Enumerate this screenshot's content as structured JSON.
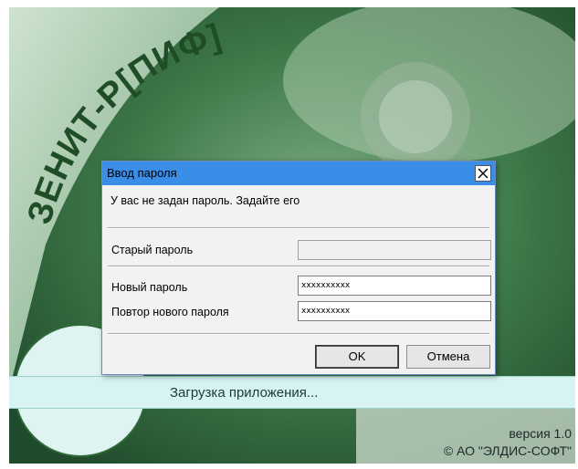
{
  "splash": {
    "brand": "ЗЕНИТ-Р[ПИФ]",
    "loading": "Загрузка приложения...",
    "version": "версия 1.0",
    "copyright": "© АО \"ЭЛДИС-СОФТ\""
  },
  "dialog": {
    "title": "Ввод пароля",
    "message": "У вас не задан пароль. Задайте его",
    "old_password_label": "Старый пароль",
    "old_password_value": "",
    "new_password_label": "Новый пароль",
    "new_password_value": "xxxxxxxxxx",
    "repeat_password_label": "Повтор нового пароля",
    "repeat_password_value": "xxxxxxxxxx",
    "ok_label": "OK",
    "cancel_label": "Отмена"
  },
  "colors": {
    "titlebar": "#3b8ee8",
    "splash_green": "#2f6b3a",
    "loading_bar": "#d7f4f2"
  }
}
